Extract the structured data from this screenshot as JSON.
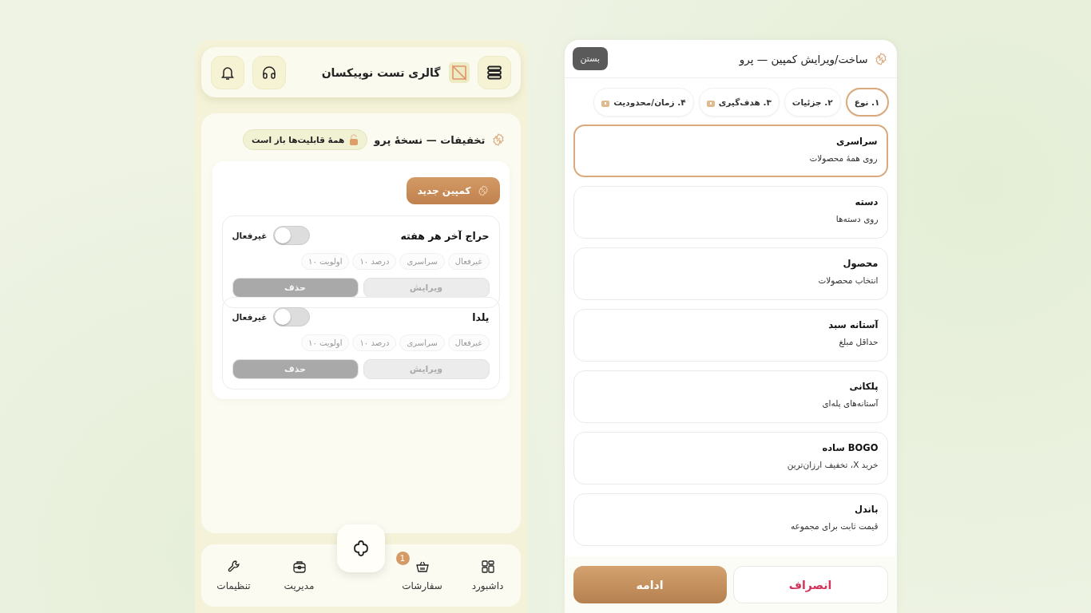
{
  "app_header": {
    "title": "گالری تست نوپیکسان"
  },
  "discounts": {
    "title": "تخفیفات — نسخهٔ پرو",
    "badge": "همهٔ قابلیت‌ها باز است",
    "new_button": "کمپین جدید",
    "campaigns": [
      {
        "name": "حراج آخر هر هفته",
        "on": false,
        "state_label": "غیرفعال",
        "tags": [
          "غیرفعال",
          "سراسری",
          "درصد ۱۰",
          "اولویت ۱۰"
        ],
        "edit": "ویرایش",
        "delete": "حذف"
      },
      {
        "name": "یلدا",
        "on": false,
        "state_label": "غیرفعال",
        "tags": [
          "غیرفعال",
          "سراسری",
          "درصد ۱۰",
          "اولویت ۱۰"
        ],
        "edit": "ویرایش",
        "delete": "حذف"
      }
    ]
  },
  "bottom_nav": [
    {
      "kind": "dashboard",
      "label": "داشبورد"
    },
    {
      "kind": "orders",
      "label": "سفارشات",
      "badge": "1"
    },
    {
      "kind": "manage",
      "label": "مدیریت"
    },
    {
      "kind": "settings",
      "label": "تنظیمات"
    }
  ],
  "modal": {
    "title": "ساخت/ویرایش کمپین — پرو",
    "close": "بستن",
    "tabs": [
      {
        "label": "۱. نوع",
        "selected": true,
        "locked": false
      },
      {
        "label": "۲. جزئیات",
        "selected": false,
        "locked": false
      },
      {
        "label": "۳. هدف‌گیری",
        "selected": false,
        "locked": true
      },
      {
        "label": "۴. زمان/محدودیت",
        "selected": false,
        "locked": true
      }
    ],
    "types": [
      {
        "title": "سراسری",
        "desc": "روی همهٔ محصولات",
        "selected": true
      },
      {
        "title": "دسته",
        "desc": "روی دسته‌ها",
        "selected": false
      },
      {
        "title": "محصول",
        "desc": "انتخاب محصولات",
        "selected": false
      },
      {
        "title": "آستانه سبد",
        "desc": "حداقل مبلغ",
        "selected": false
      },
      {
        "title": "پلکانی",
        "desc": "آستانه‌های پله‌ای",
        "selected": false
      },
      {
        "title": "BOGO ساده",
        "desc": "خرید X، تخفیف ارزان‌ترین",
        "selected": false
      },
      {
        "title": "باندل",
        "desc": "قیمت ثابت برای مجموعه",
        "selected": false
      }
    ],
    "cancel": "انصراف",
    "continue": "ادامه"
  }
}
